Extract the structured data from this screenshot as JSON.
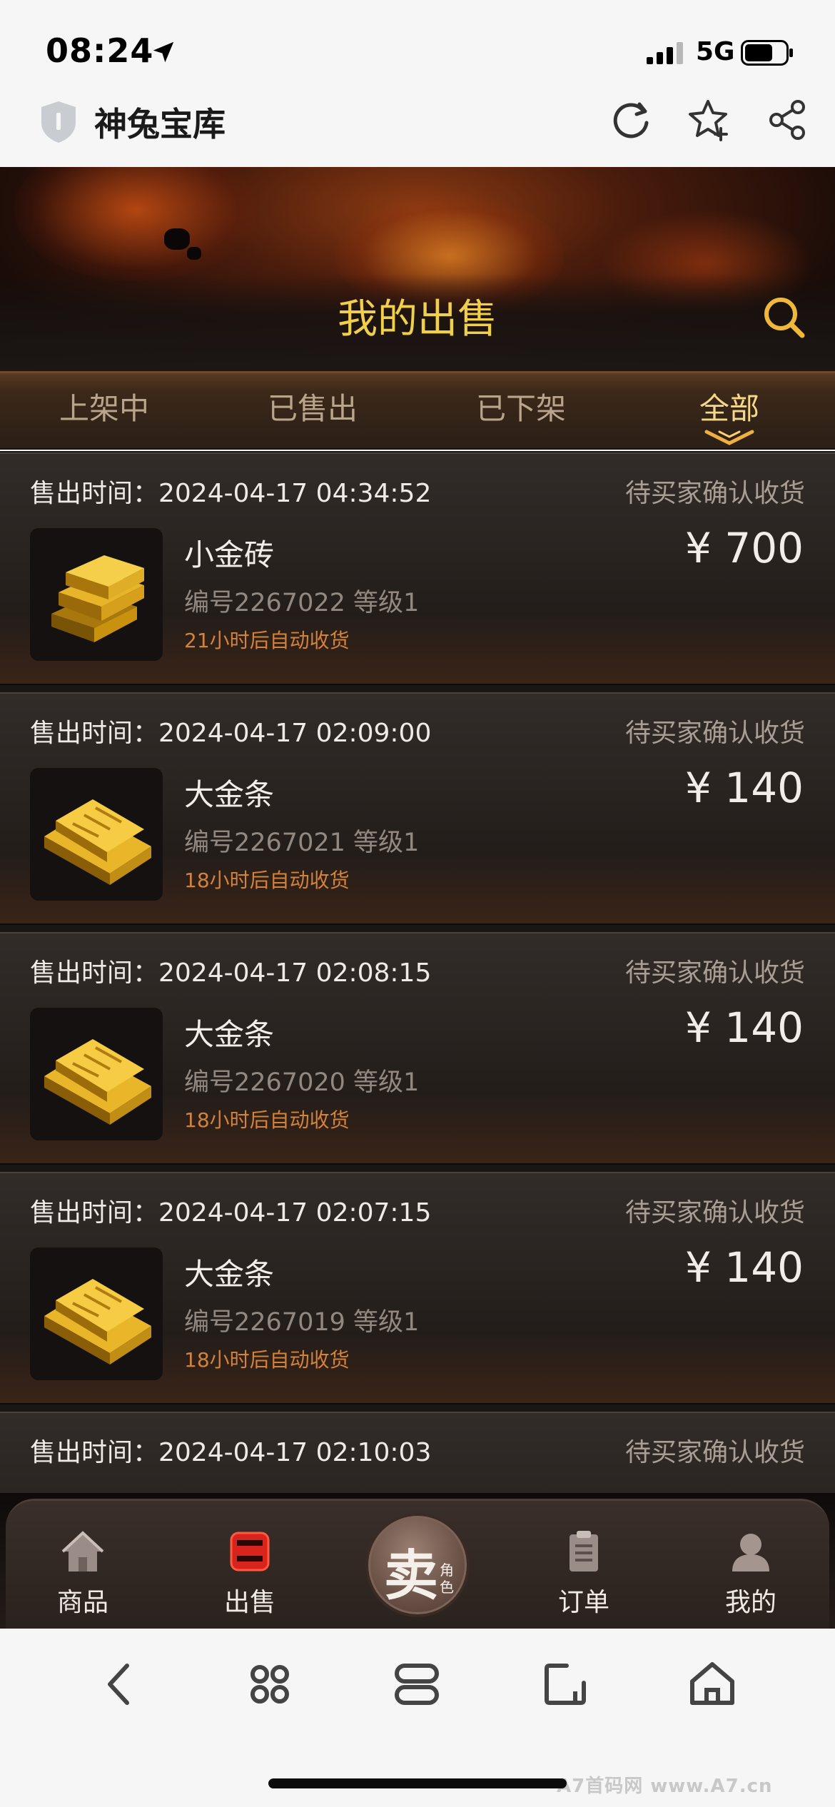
{
  "status_bar": {
    "time": "08:24",
    "network": "5G"
  },
  "browser": {
    "site_title": "神兔宝库"
  },
  "header": {
    "title": "我的出售"
  },
  "tabs": [
    {
      "label": "上架中"
    },
    {
      "label": "已售出"
    },
    {
      "label": "已下架"
    },
    {
      "label": "全部",
      "active": true
    }
  ],
  "orders": [
    {
      "sale_time": "售出时间：2024-04-17 04:34:52",
      "status": "待买家确认收货",
      "name": "小金砖",
      "meta": "编号2267022   等级1",
      "note": "21小时后自动收货",
      "price": "¥ 700",
      "icon": "small-gold-brick"
    },
    {
      "sale_time": "售出时间：2024-04-17 02:09:00",
      "status": "待买家确认收货",
      "name": "大金条",
      "meta": "编号2267021   等级1",
      "note": "18小时后自动收货",
      "price": "¥ 140",
      "icon": "gold-bars"
    },
    {
      "sale_time": "售出时间：2024-04-17 02:08:15",
      "status": "待买家确认收货",
      "name": "大金条",
      "meta": "编号2267020   等级1",
      "note": "18小时后自动收货",
      "price": "¥ 140",
      "icon": "gold-bars"
    },
    {
      "sale_time": "售出时间：2024-04-17 02:07:15",
      "status": "待买家确认收货",
      "name": "大金条",
      "meta": "编号2267019   等级1",
      "note": "18小时后自动收货",
      "price": "¥ 140",
      "icon": "gold-bars"
    },
    {
      "sale_time": "售出时间：2024-04-17 02:10:03",
      "status": "待买家确认收货"
    }
  ],
  "bottom_nav": {
    "items": [
      {
        "label": "商品",
        "icon": "house-icon"
      },
      {
        "label": "出售",
        "icon": "sell-box-icon",
        "active": true
      },
      {
        "label": "订单",
        "icon": "clipboard-icon"
      },
      {
        "label": "我的",
        "icon": "user-icon"
      }
    ],
    "sell_button": {
      "main": "卖",
      "sub": "角色"
    }
  },
  "watermark": "A7首码网  www.A7.cn",
  "colors": {
    "title_gold": "#f0cf4a",
    "note_orange": "#d3823a",
    "active_tab": "#f5d88a"
  }
}
